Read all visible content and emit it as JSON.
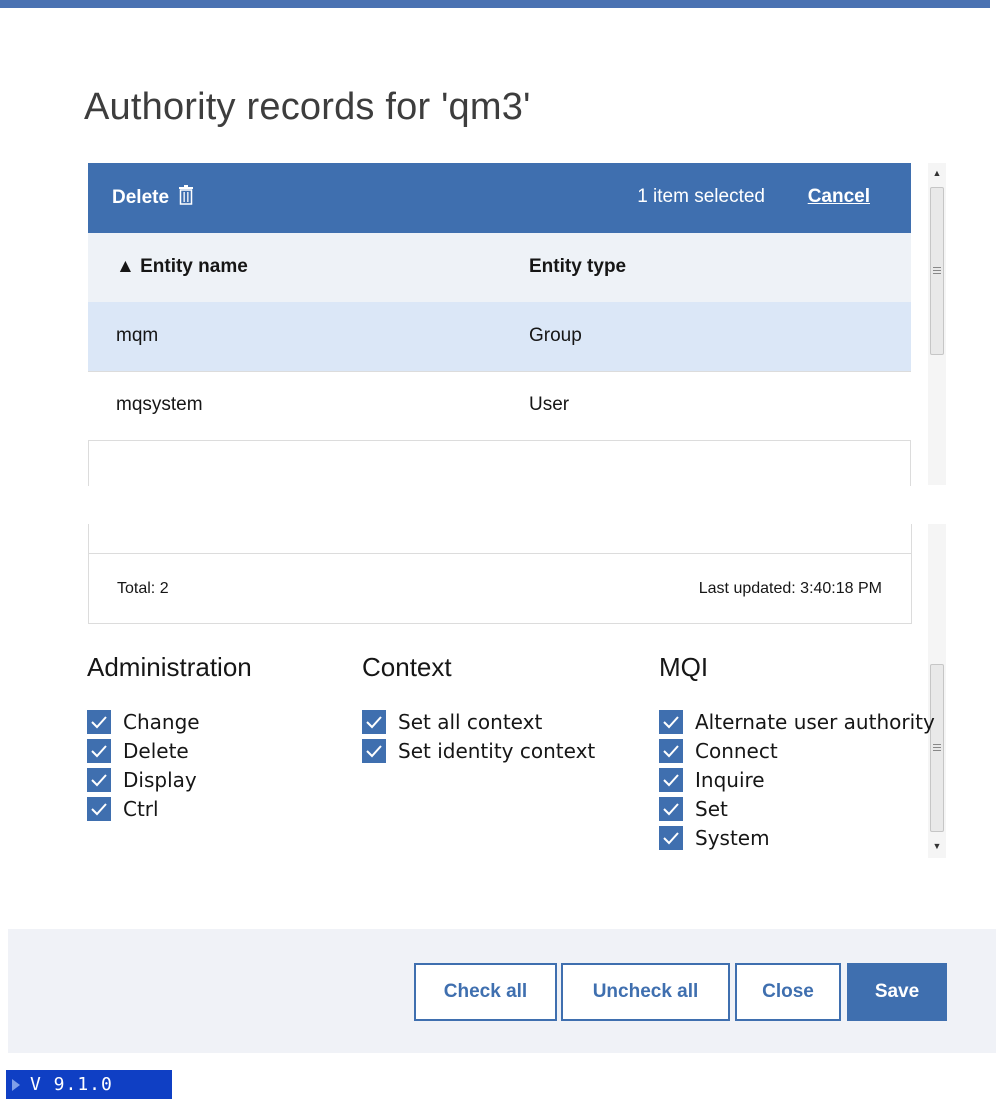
{
  "dialog": {
    "title": "Authority records for 'qm3'"
  },
  "toolbar": {
    "delete_label": "Delete",
    "selected_text": "1 item selected",
    "cancel_label": "Cancel"
  },
  "table": {
    "columns": [
      "▲ Entity name",
      "Entity type"
    ],
    "rows": [
      {
        "name": "mqm",
        "type": "Group",
        "selected": true
      },
      {
        "name": "mqsystem",
        "type": "User",
        "selected": false
      }
    ],
    "total": "Total: 2",
    "last_updated": "Last updated: 3:40:18 PM"
  },
  "permissions": {
    "administration": {
      "title": "Administration",
      "items": [
        "Change",
        "Delete",
        "Display",
        "Ctrl"
      ]
    },
    "context": {
      "title": "Context",
      "items": [
        "Set all context",
        "Set identity context"
      ]
    },
    "mqi": {
      "title": "MQI",
      "items": [
        "Alternate user authority",
        "Connect",
        "Inquire",
        "Set",
        "System"
      ]
    }
  },
  "actions": {
    "check_all": "Check all",
    "uncheck_all": "Uncheck all",
    "close": "Close",
    "save": "Save"
  },
  "version": "V 9.1.0",
  "colors": {
    "accent": "#3f6faf",
    "selected_row": "#dbe7f7",
    "header_row": "#eef2f7",
    "action_bar": "#f0f2f7",
    "version_badge": "#0f3fc4"
  }
}
